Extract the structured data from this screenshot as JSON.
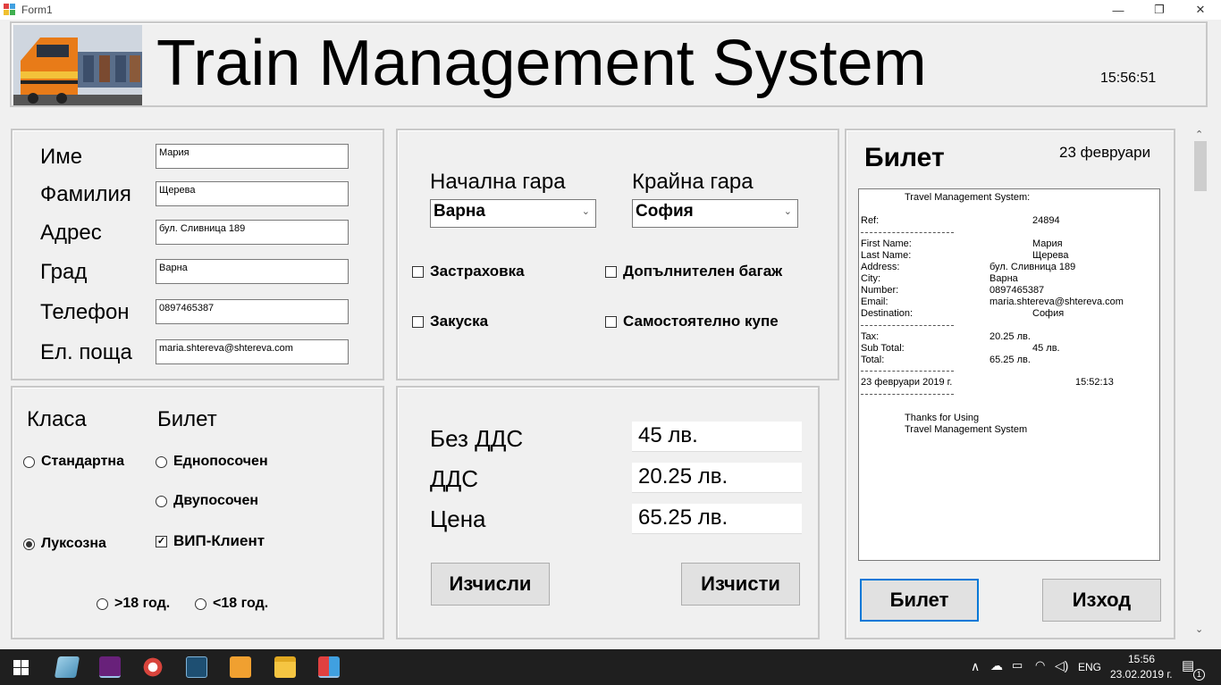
{
  "window": {
    "title": "Form1",
    "minimize": "—",
    "maximize": "❐",
    "close": "✕"
  },
  "header": {
    "title": "Train Management System",
    "clock": "15:56:51"
  },
  "customer": {
    "labels": [
      "Име",
      "Фамилия",
      "Адрес",
      "Град",
      "Телефон",
      "Ел. поща"
    ],
    "values": [
      "Мария",
      "Щерева",
      "бул. Сливница 189",
      "Варна",
      "0897465387",
      "maria.shtereva@shtereva.com"
    ]
  },
  "route": {
    "start_label": "Начална гара",
    "start_value": "Варна",
    "end_label": "Крайна гара",
    "end_value": "София",
    "options": [
      {
        "label": "Застраховка",
        "checked": false
      },
      {
        "label": "Допълнителен багаж",
        "checked": false
      },
      {
        "label": "Закуска",
        "checked": false
      },
      {
        "label": "Самостоятелно купе",
        "checked": false
      }
    ]
  },
  "class_section": {
    "class_label": "Класа",
    "ticket_label": "Билет",
    "standard": "Стандартна",
    "luxury": "Луксозна",
    "oneway": "Еднопосочен",
    "twoway": "Двупосочен",
    "vip": "ВИП-Клиент",
    "over18": ">18 год.",
    "under18": "<18 год.",
    "selected_class": "Луксозна",
    "vip_checked": true
  },
  "pricing": {
    "no_vat_label": "Без ДДС",
    "no_vat_value": "45 лв.",
    "vat_label": "ДДС",
    "vat_value": "20.25 лв.",
    "total_label": "Цена",
    "total_value": "65.25 лв.",
    "calc_button": "Изчисли",
    "clear_button": "Изчисти"
  },
  "ticket_panel": {
    "title": "Билет",
    "date": "23 февруари",
    "ticket_button": "Билет",
    "exit_button": "Изход"
  },
  "receipt": {
    "header": "Travel Management System:",
    "ref_label": "Ref:",
    "ref_value": "24894",
    "first_name_label": "First Name:",
    "first_name": "Мария",
    "last_name_label": "Last Name:",
    "last_name": "Щерева",
    "address_label": "Address:",
    "address": "бул. Сливница 189",
    "city_label": "City:",
    "city": "Варна",
    "number_label": "Number:",
    "number": "0897465387",
    "email_label": "Email:",
    "email": "maria.shtereva@shtereva.com",
    "destination_label": "Destination:",
    "destination": "София",
    "tax_label": "Tax:",
    "tax": "20.25 лв.",
    "subtotal_label": "Sub Total:",
    "subtotal": "45 лв.",
    "total_label": "Total:",
    "total": "65.25 лв.",
    "date": "23 февруари 2019 г.",
    "time": "15:52:13",
    "thanks_1": "Thanks for Using",
    "thanks_2": "Travel Management System"
  },
  "taskbar": {
    "lang": "ENG",
    "time": "15:56",
    "date": "23.02.2019 г.",
    "notif_count": "1"
  },
  "colors": {
    "focus_border": "#0078d7",
    "taskbar_bg": "#1f1f1f"
  }
}
